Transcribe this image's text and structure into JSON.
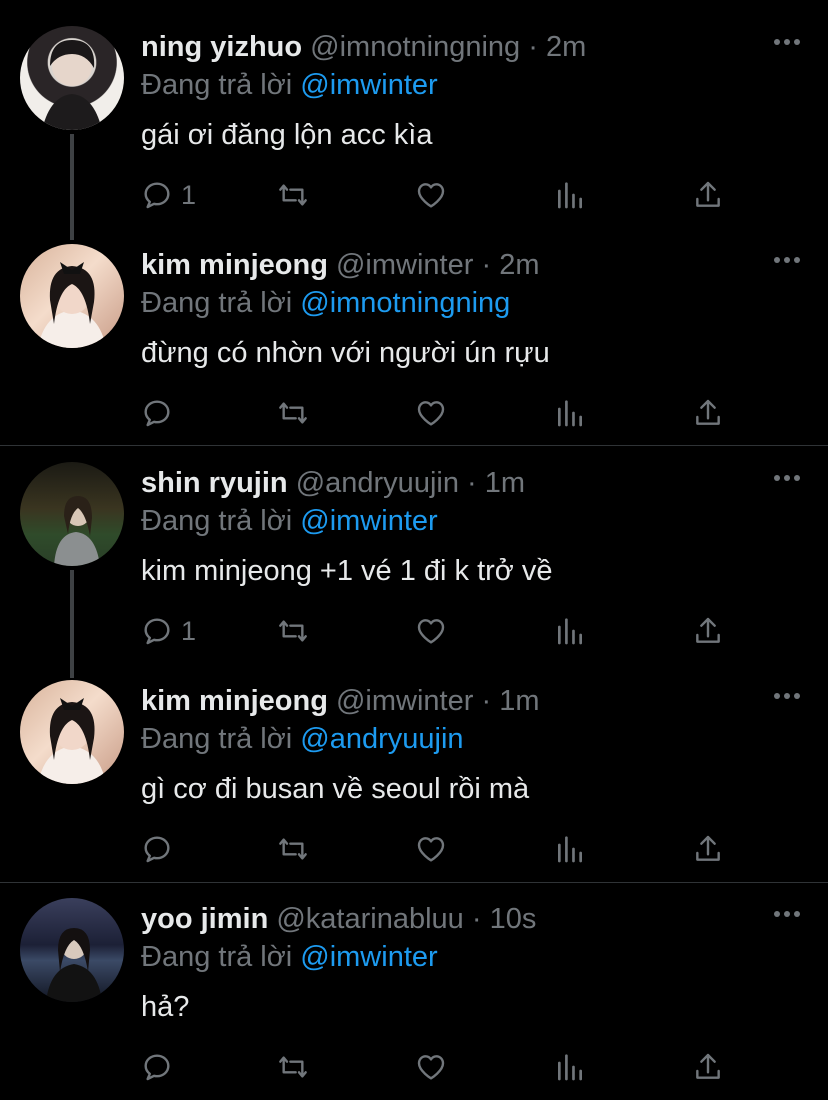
{
  "reply_prefix": "Đang trả lời",
  "tweets": [
    {
      "name": "ning yizhuo",
      "handle": "@imnotningning",
      "dot": "·",
      "time": "2m",
      "reply_to": "@imwinter",
      "text": "gái ơi đăng lộn acc kìa",
      "reply_count": "1"
    },
    {
      "name": "kim minjeong",
      "handle": "@imwinter",
      "dot": "·",
      "time": "2m",
      "reply_to": "@imnotningning",
      "text": "đừng có nhờn với người ún rựu",
      "reply_count": ""
    },
    {
      "name": "shin ryujin",
      "handle": "@andryuujin",
      "dot": "·",
      "time": "1m",
      "reply_to": "@imwinter",
      "text": "kim minjeong +1 vé 1 đi k trở về",
      "reply_count": "1"
    },
    {
      "name": "kim minjeong",
      "handle": "@imwinter",
      "dot": "·",
      "time": "1m",
      "reply_to": "@andryuujin",
      "text": "gì cơ đi busan về seoul rồi mà",
      "reply_count": ""
    },
    {
      "name": "yoo jimin",
      "handle": "@katarinabluu",
      "dot": "·",
      "time": "10s",
      "reply_to": "@imwinter",
      "text": "hả?",
      "reply_count": ""
    }
  ],
  "colors": {
    "background": "#000000",
    "text": "#e7e9ea",
    "secondary": "#71767b",
    "mention": "#1d9bf0",
    "divider": "#2f3336",
    "thread_line": "#3e4144"
  },
  "icons": [
    "more-icon",
    "reply-icon",
    "retweet-icon",
    "like-icon",
    "views-icon",
    "share-icon"
  ]
}
